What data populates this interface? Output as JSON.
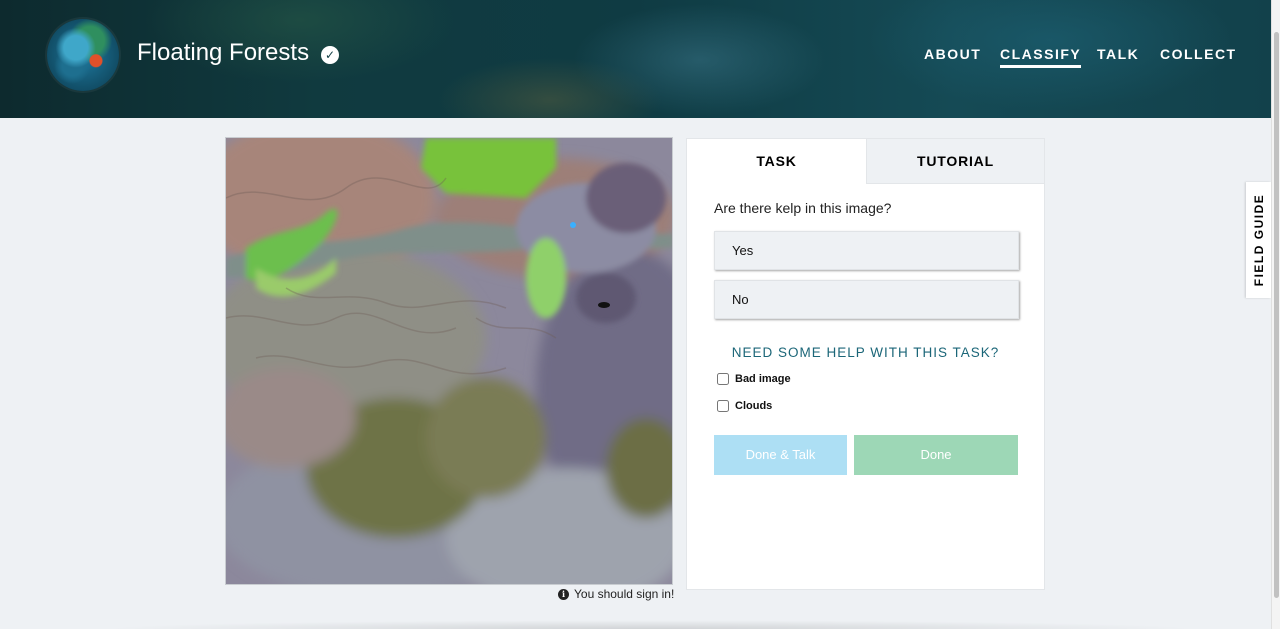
{
  "header": {
    "title": "Floating Forests",
    "verified_icon": "check-circle-icon",
    "nav": [
      {
        "label": "ABOUT",
        "active": false
      },
      {
        "label": "CLASSIFY",
        "active": true
      },
      {
        "label": "TALK",
        "active": false
      },
      {
        "label": "COLLECT",
        "active": false
      }
    ]
  },
  "subject": {
    "signin_text": "You should sign in!",
    "signin_icon": "info-icon"
  },
  "task_panel": {
    "tabs": {
      "task": "TASK",
      "tutorial": "TUTORIAL"
    },
    "question": "Are there kelp in this image?",
    "answers": {
      "yes": "Yes",
      "no": "No"
    },
    "help_link": "NEED SOME HELP WITH THIS TASK?",
    "checkboxes": {
      "bad_image": "Bad image",
      "clouds": "Clouds"
    },
    "buttons": {
      "done_talk": "Done & Talk",
      "done": "Done"
    }
  },
  "field_guide": {
    "label": "FIELD GUIDE"
  },
  "colors": {
    "accent_link": "#1b6678",
    "done_talk_bg": "#addff4",
    "done_bg": "#9dd7b6",
    "page_bg": "#eef1f4"
  }
}
